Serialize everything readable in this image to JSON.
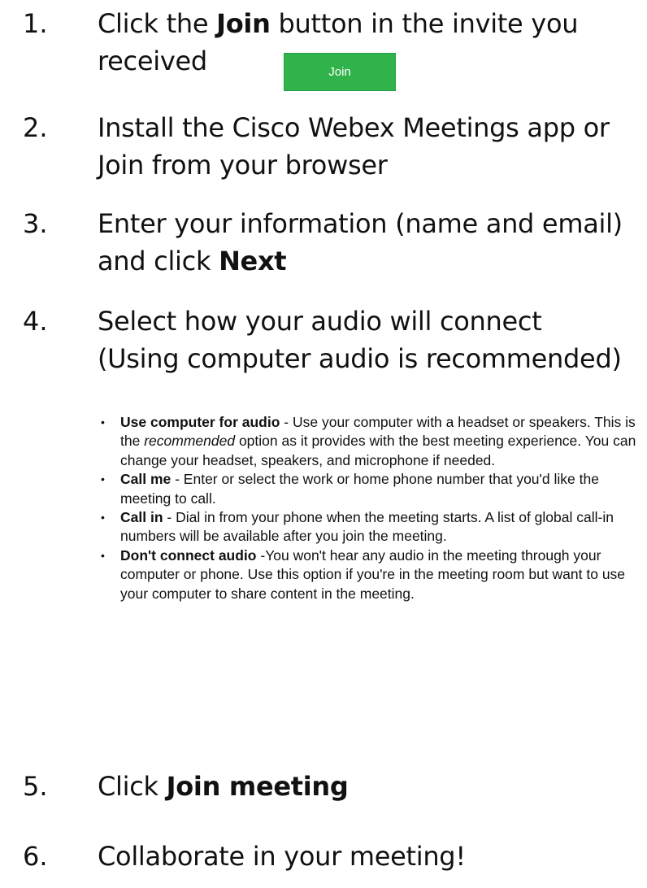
{
  "steps": [
    {
      "number": "1.",
      "before": "Click the ",
      "bold": "Join",
      "after": " button in the invite you",
      "line2": "received"
    },
    {
      "number": "2.",
      "line1": "Install the Cisco Webex Meetings app or",
      "line2": "Join from your browser"
    },
    {
      "number": "3.",
      "line1": "Enter your information (name and email)",
      "line2_before": "and click ",
      "line2_bold": "Next"
    },
    {
      "number": "4.",
      "line1": "Select how your audio will connect",
      "line2": "(Using computer audio is recommended)"
    },
    {
      "number": "5.",
      "before": "Click ",
      "bold": "Join meeting"
    },
    {
      "number": "6.",
      "text": "Collaborate in your meeting!"
    }
  ],
  "join_button": {
    "label": "Join",
    "color": "#2fb34a"
  },
  "audio_options": [
    {
      "name": "Use computer for audio",
      "desc_before": " - Use your computer with a headset or speakers. This is the ",
      "desc_italic": "recommended",
      "desc_after": " option as it provides with the best meeting experience. You can change your headset, speakers, and microphone if needed."
    },
    {
      "name": "Call me",
      "desc": " - Enter or select the work or home phone number that you'd like the meeting to call."
    },
    {
      "name": "Call in",
      "desc": " - Dial in from your phone when the meeting starts. A list of global call-in numbers will be available after you join the meeting."
    },
    {
      "name": "Don't connect audio",
      "desc": " -You won't hear any audio in the meeting through your computer or phone. Use this option if you're in the meeting room but want to use your computer to share content in the meeting."
    }
  ],
  "bullet_glyph": "•"
}
